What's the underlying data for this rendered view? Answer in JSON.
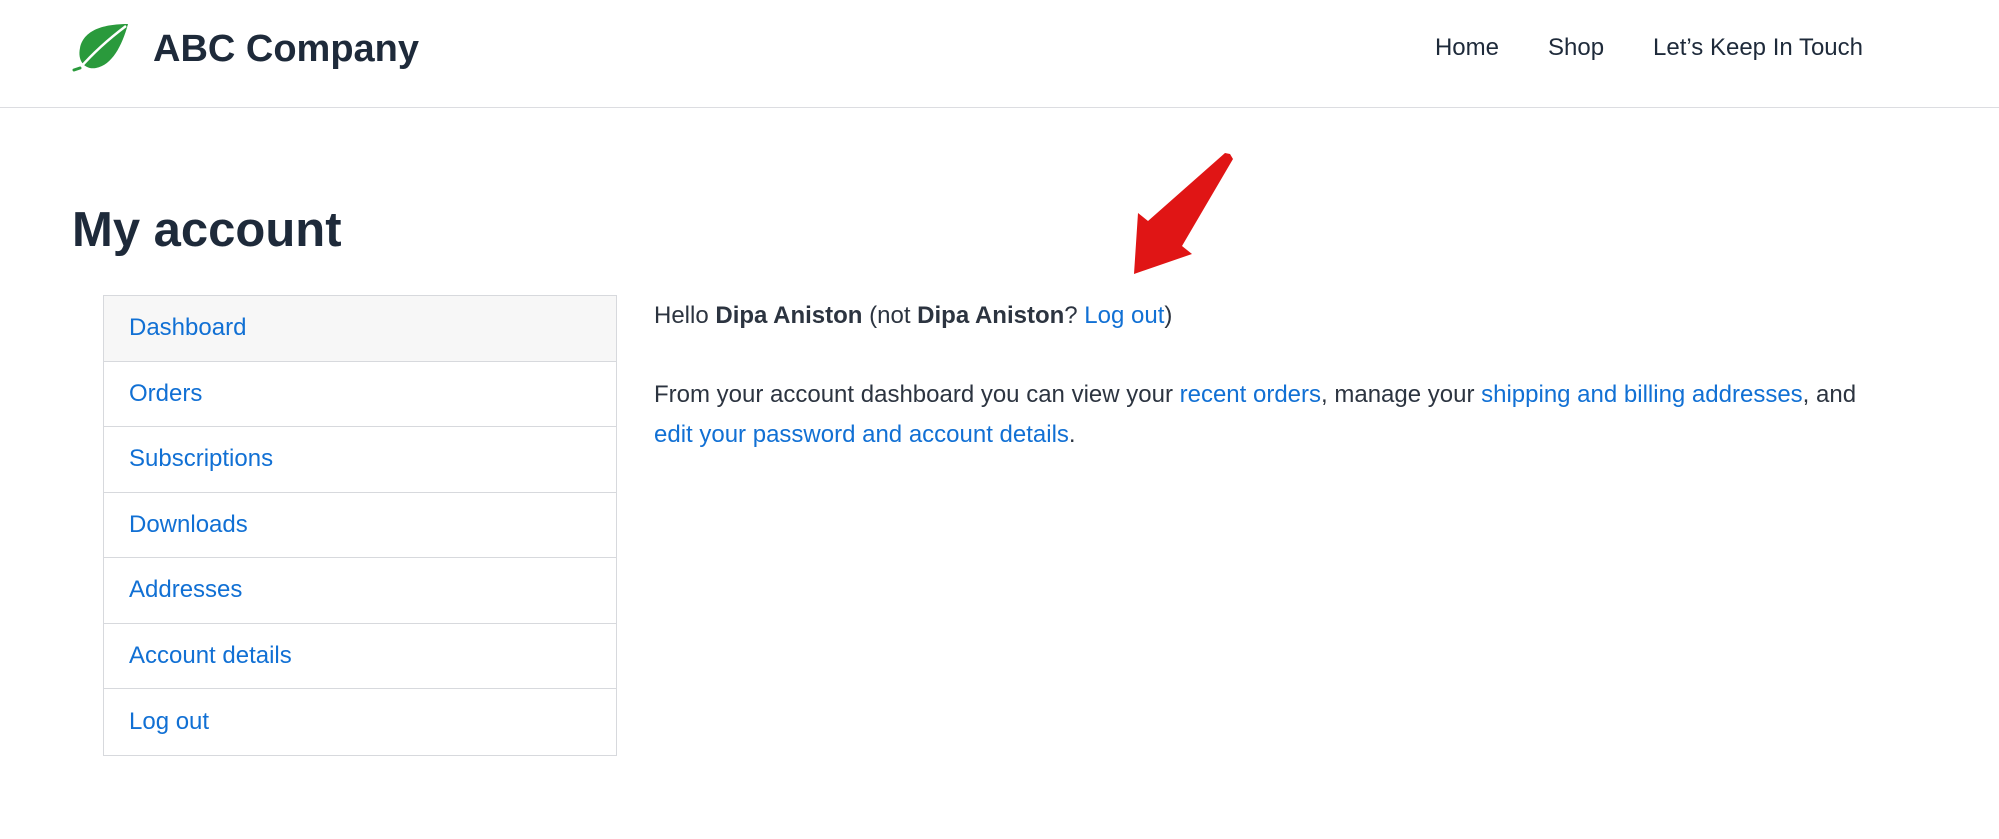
{
  "header": {
    "site_title": "ABC Company",
    "nav": [
      {
        "label": "Home"
      },
      {
        "label": "Shop"
      },
      {
        "label": "Let’s Keep In Touch"
      }
    ]
  },
  "page": {
    "title": "My account"
  },
  "account_nav": {
    "items": [
      {
        "label": "Dashboard",
        "active": true
      },
      {
        "label": "Orders"
      },
      {
        "label": "Subscriptions"
      },
      {
        "label": "Downloads"
      },
      {
        "label": "Addresses"
      },
      {
        "label": "Account details"
      },
      {
        "label": "Log out"
      }
    ]
  },
  "dashboard": {
    "greeting_prefix": "Hello ",
    "user_name": "Dipa Aniston",
    "not_prefix": " (not ",
    "not_name": "Dipa Aniston",
    "not_suffix": "? ",
    "logout_link": "Log out",
    "closing_paren": ")",
    "text_1": "From your account dashboard you can view your ",
    "link_recent_orders": "recent orders",
    "text_2": ", manage your ",
    "link_addresses": "shipping and billing addresses",
    "text_3": ", and ",
    "link_account_details": "edit your password and account details",
    "text_4": "."
  },
  "colors": {
    "link": "#1170d4",
    "text": "#1e2a3a",
    "logo_green": "#2a9a3c",
    "annotation_arrow": "#e01515"
  },
  "icons": {
    "logo": "leaf-icon",
    "annotation": "arrow-annotation"
  }
}
